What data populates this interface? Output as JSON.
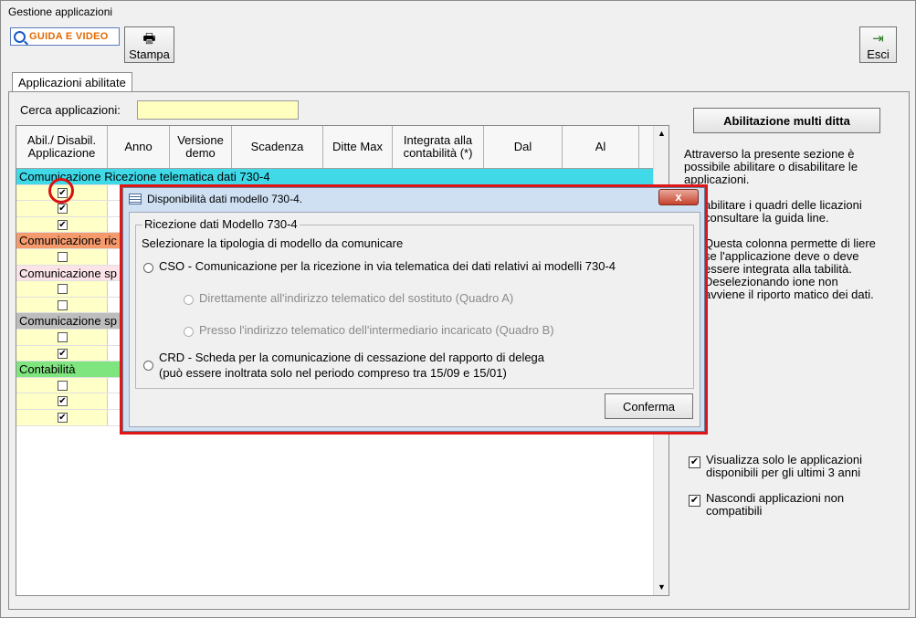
{
  "window": {
    "title": "Gestione applicazioni"
  },
  "toolbar": {
    "guida_label": "GUIDA E VIDEO",
    "stampa_label": "Stampa",
    "esci_label": "Esci"
  },
  "tabs": [
    {
      "label": "Applicazioni abilitate"
    }
  ],
  "search": {
    "label": "Cerca applicazioni:",
    "value": ""
  },
  "grid": {
    "headers": {
      "abil": "Abil./ Disabil. Applicazione",
      "anno": "Anno",
      "versione": "Versione demo",
      "scadenza": "Scadenza",
      "ditte": "Ditte Max",
      "integrata": "Integrata alla contabilità (*)",
      "dal": "Dal",
      "al": "Al"
    },
    "groups": [
      {
        "label": "Comunicazione Ricezione telematica dati 730-4",
        "color": "#3fd9e8"
      },
      {
        "label": "Comunicazione ric",
        "color": "#f59a6c"
      },
      {
        "label": "Comunicazione sp",
        "color": "#fbe3e8"
      },
      {
        "label": "Comunicazione sp",
        "color": "#bdbdbd"
      },
      {
        "label": "Contabilità",
        "color": "#7fe57f"
      }
    ],
    "check_mark": "✔"
  },
  "right_panel": {
    "multi_label": "Abilitazione multi ditta",
    "desc_1": "Attraverso la presente sezione è possibile abilitare o disabilitare le applicazioni.",
    "desc_2": "abilitare i quadri delle licazioni consultare la guida line.",
    "desc_3": "Questa colonna permette di liere se l'applicazione deve o deve essere integrata alla tabilità. Deselezionando ione non avviene il riporto matico dei dati.",
    "opt1": "Visualizza solo le applicazioni disponibili per gli ultimi 3 anni",
    "opt2": "Nascondi applicazioni non compatibili"
  },
  "dialog": {
    "title": "Disponibilità dati modello 730-4.",
    "close": "x",
    "group_label": "Ricezione dati Modello 730-4",
    "instruction": "Selezionare la tipologia di modello da comunicare",
    "cso": "CSO - Comunicazione per la ricezione in via telematica dei dati relativi ai modelli 730-4",
    "quadro_a": "Direttamente all'indirizzo telematico del sostituto (Quadro A)",
    "quadro_b": "Presso l'indirizzo telematico dell'intermediario incaricato (Quadro B)",
    "crd_1": "CRD - Scheda per la comunicazione di cessazione del rapporto di delega",
    "crd_2": "(può essere inoltrata solo nel periodo compreso tra 15/09 e 15/01)",
    "confirm": "Conferma"
  }
}
